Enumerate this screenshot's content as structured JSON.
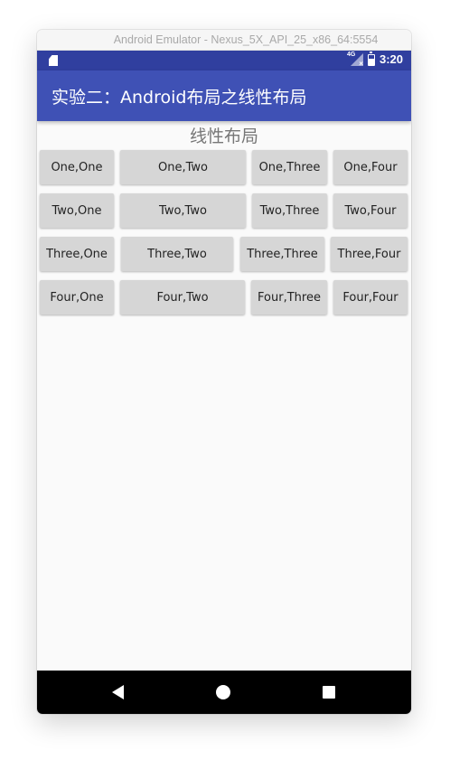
{
  "window": {
    "title": "Android Emulator - Nexus_5X_API_25_x86_64:5554"
  },
  "statusbar": {
    "network_label": "4G",
    "time": "3:20",
    "icons": [
      "sd-card-icon",
      "network-icon",
      "battery-icon"
    ]
  },
  "appbar": {
    "title": "实验二：Android布局之线性布局",
    "color": "#3f51b5"
  },
  "content": {
    "heading": "线性布局",
    "rows": [
      [
        "One,One",
        "One,Two",
        "One,Three",
        "One,Four"
      ],
      [
        "Two,One",
        "Two,Two",
        "Two,Three",
        "Two,Four"
      ],
      [
        "Three,One",
        "Three,Two",
        "Three,Three",
        "Three,Four"
      ],
      [
        "Four,One",
        "Four,Two",
        "Four,Three",
        "Four,Four"
      ]
    ]
  },
  "navbar": {
    "icons": [
      "back-icon",
      "home-icon",
      "recents-icon"
    ]
  },
  "colors": {
    "statusbar": "#303f9f",
    "appbar": "#3f51b5",
    "button": "#d6d6d6"
  }
}
